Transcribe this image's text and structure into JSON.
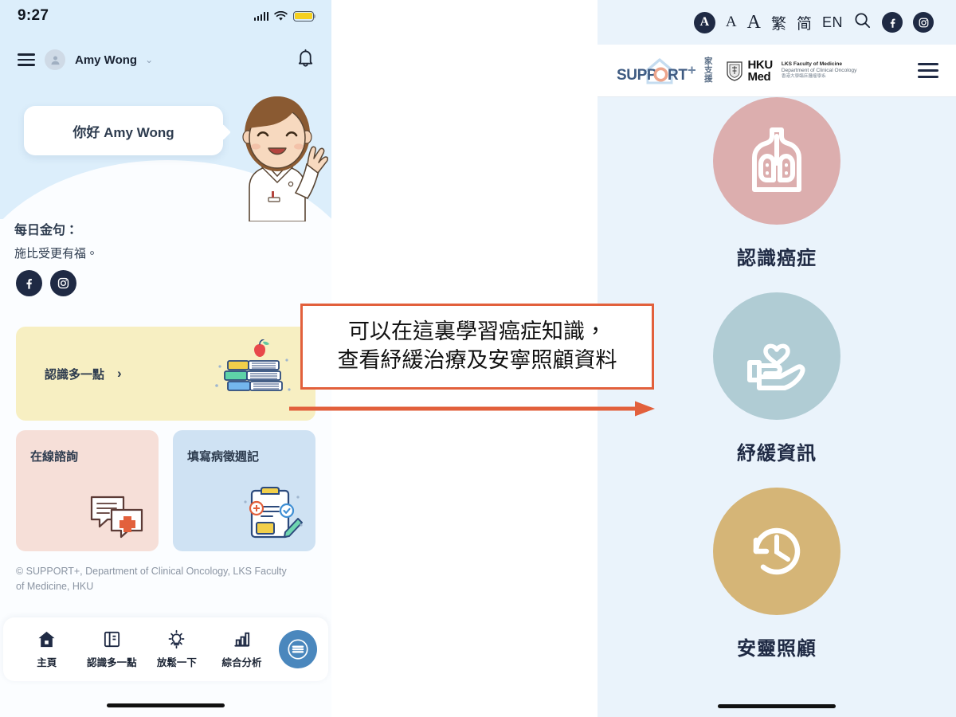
{
  "phone": {
    "status_bar": {
      "time": "9:27",
      "signal_icon": "cellular-signal-icon",
      "wifi_icon": "wifi-icon",
      "battery_icon": "battery-icon"
    },
    "header": {
      "menu_icon": "hamburger-menu-icon",
      "avatar_icon": "user-avatar-icon",
      "user_name": "Amy Wong",
      "caret_icon": "chevron-down-icon",
      "notification_icon": "bell-icon"
    },
    "greeting": {
      "bubble_text": "你好 Amy Wong",
      "mascot_icon": "waving-nurse-illustration"
    },
    "quote": {
      "heading": "每日金句：",
      "text": "施比受更有福。",
      "facebook_icon": "facebook-icon",
      "instagram_icon": "instagram-icon"
    },
    "cards": {
      "learn": {
        "label": "認識多一點",
        "chevron": "›",
        "icon": "stack-of-books-icon",
        "color": "#f7efc2"
      },
      "tiles": [
        {
          "label": "在線諮詢",
          "icon": "chat-bubbles-medical-icon",
          "color": "#f6dfd8"
        },
        {
          "label": "填寫病徵週記",
          "icon": "clipboard-checklist-icon",
          "color": "#cfe2f3"
        }
      ]
    },
    "copyright": "© SUPPORT+, Department of Clinical Oncology, LKS Faculty of Medicine, HKU",
    "bottom_nav": {
      "items": [
        {
          "label": "主頁",
          "icon": "home-icon",
          "active": true
        },
        {
          "label": "認識多一點",
          "icon": "book-icon",
          "active": false
        },
        {
          "label": "放鬆一下",
          "icon": "lightbulb-icon",
          "active": false
        },
        {
          "label": "綜合分析",
          "icon": "bar-chart-icon",
          "active": false
        }
      ],
      "fab_icon": "chat-list-icon",
      "fab_color": "#4a87bd"
    }
  },
  "website": {
    "utility_bar": {
      "font_size_small": "A",
      "font_size_medium": "A",
      "font_size_large": "A",
      "lang_traditional": "繁",
      "lang_simplified": "简",
      "lang_english": "EN",
      "search_icon": "search-icon",
      "facebook_icon": "facebook-icon",
      "instagram_icon": "instagram-icon"
    },
    "header": {
      "logo_text": "SUPPORT",
      "logo_cn_1": "家",
      "logo_cn_2": "支",
      "logo_cn_3": "援",
      "hku_crest_icon": "hku-crest-icon",
      "hku_mark_line1": "HKU",
      "hku_mark_line2": "Med",
      "hku_text_1": "LKS Faculty of Medicine",
      "hku_text_2": "Department of Clinical Oncology",
      "hku_text_3": "香港大學臨床腫瘤學系",
      "menu_icon": "hamburger-menu-icon"
    },
    "tiles": [
      {
        "label": "認識癌症",
        "icon": "lungs-icon",
        "color": "#dcaeae"
      },
      {
        "label": "紓緩資訊",
        "icon": "hand-heart-icon",
        "color": "#b0ccd4"
      },
      {
        "label": "安靈照顧",
        "icon": "clock-rewind-icon",
        "color": "#d5b577"
      }
    ]
  },
  "annotation": {
    "line1": "可以在這裏學習癌症知識，",
    "line2": "查看紓緩治療及安寧照顧資料",
    "border_color": "#e2603c",
    "arrow_color": "#e2603c",
    "arrow_icon": "right-arrow-icon"
  }
}
